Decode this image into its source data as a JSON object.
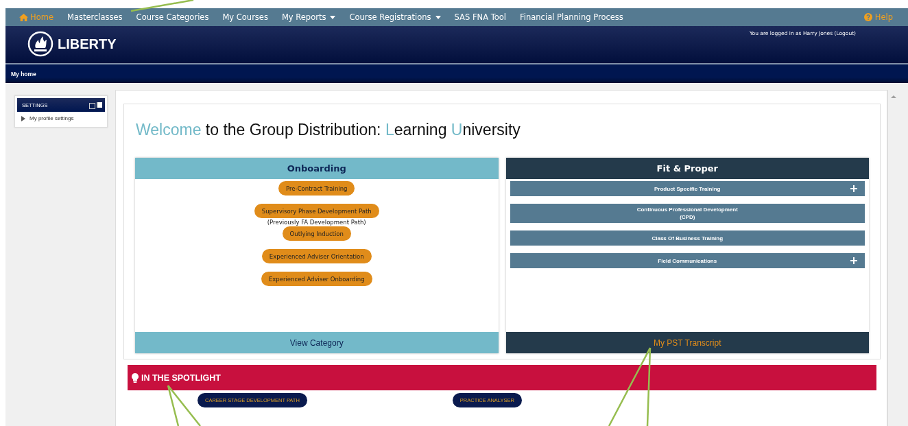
{
  "nav": {
    "items": [
      {
        "label": "Home",
        "selected": true,
        "kind": "home"
      },
      {
        "label": "Masterclasses",
        "selected": false,
        "kind": "link"
      },
      {
        "label": "Course Categories",
        "selected": false,
        "kind": "link"
      },
      {
        "label": "My Courses",
        "selected": false,
        "kind": "link"
      },
      {
        "label": "My Reports",
        "selected": false,
        "kind": "menu"
      },
      {
        "label": "Course Registrations",
        "selected": false,
        "kind": "menu"
      },
      {
        "label": "SAS FNA Tool",
        "selected": false,
        "kind": "link"
      },
      {
        "label": "Financial Planning Process",
        "selected": false,
        "kind": "link"
      }
    ],
    "help": "Help"
  },
  "header": {
    "logo": "LIBERTY",
    "login_text": "You are logged in as Harry Jones",
    "logout": "(Logout)"
  },
  "breadcrumb": "My home",
  "settings_block": {
    "title": "SETTINGS",
    "items": [
      {
        "label": "My profile settings",
        "expanded": false
      }
    ]
  },
  "welcome": {
    "title": [
      {
        "text": "Welcome",
        "accent": true
      },
      {
        "text": " to the Group Distribution: ",
        "accent": false
      },
      {
        "text": "L",
        "accent": true
      },
      {
        "text": "earning ",
        "accent": false
      },
      {
        "text": "U",
        "accent": true
      },
      {
        "text": "niversity",
        "accent": false
      }
    ]
  },
  "onboarding": {
    "title": "Onboarding",
    "buttons": [
      {
        "label": "Pre-Contract Training"
      },
      {
        "label": "Supervisory Phase Development Path",
        "note": "(Previously FA Development Path)"
      },
      {
        "label": "Outlying Induction"
      },
      {
        "label": "Experienced Adviser Orientation"
      },
      {
        "label": "Experienced Adviser Onboarding"
      }
    ],
    "footer": "View Category"
  },
  "fit_proper": {
    "title": "Fit & Proper",
    "items": [
      {
        "label": "Product Specific Training",
        "expandable": true
      },
      {
        "label": "Continuous Professional Development\n(CPD)",
        "expandable": false
      },
      {
        "label": "Class Of Business Training",
        "expandable": false
      },
      {
        "label": "Field Communications",
        "expandable": true
      }
    ],
    "footer": "My PST Transcript"
  },
  "spotlight": {
    "title": "IN THE SPOTLIGHT",
    "buttons": [
      "CAREER STAGE DEVELOPMENT PATH",
      "PRACTICE ANALYSER"
    ]
  }
}
